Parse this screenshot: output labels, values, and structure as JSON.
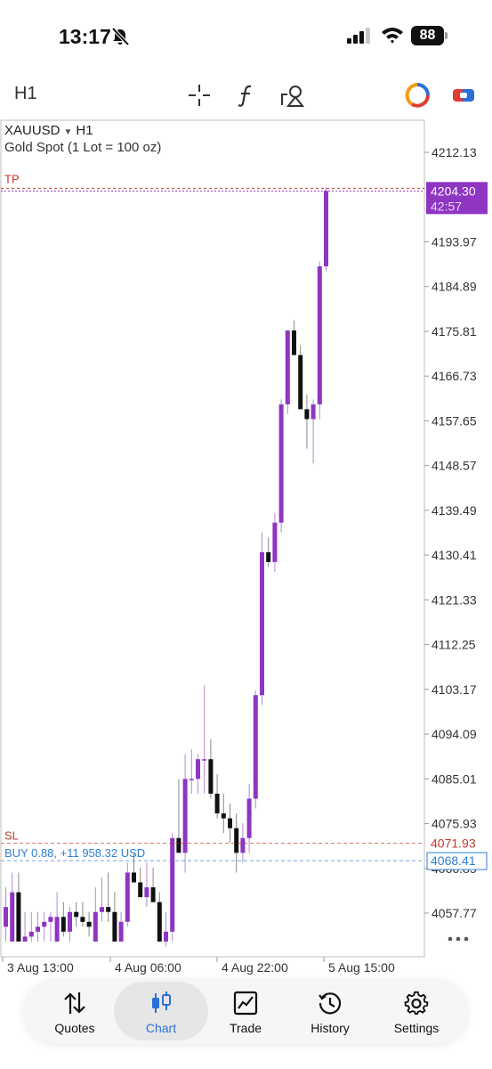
{
  "status_bar": {
    "time": "13:17",
    "battery": "88"
  },
  "toolbar": {
    "timeframe": "H1",
    "icons": [
      "crosshair-icon",
      "function-icon",
      "objects-icon",
      "account-icon",
      "trade-toggle-icon"
    ]
  },
  "tabs": [
    "Quotes",
    "Chart",
    "Trade",
    "History",
    "Settings"
  ],
  "active_tab": "Chart",
  "chart": {
    "symbol": "XAUUSD",
    "timeframe": "H1",
    "description": "Gold Spot (1 Lot = 100 oz)",
    "price_axis": [
      "4212.13",
      "4193.97",
      "4184.89",
      "4175.81",
      "4166.73",
      "4157.65",
      "4148.57",
      "4139.49",
      "4130.41",
      "4121.33",
      "4112.25",
      "4103.17",
      "4094.09",
      "4085.01",
      "4075.93",
      "4066.85",
      "4057.77"
    ],
    "time_axis": [
      "3 Aug 13:00",
      "4 Aug 06:00",
      "4 Aug 22:00",
      "5 Aug 15:00"
    ],
    "current_price": "4204.30",
    "countdown": "42:57",
    "tp_label": "TP",
    "sl_label": "SL",
    "sl_price": "4071.93",
    "position_label": "BUY 0.88, +11 958.32 USD",
    "position_price": "4068.41",
    "colors": {
      "bull": "#8e35c2",
      "bear": "#111111",
      "current": "#8e35c2",
      "tp": "#c0392b",
      "sl": "#c0392b",
      "position": "#2f7fd6"
    }
  },
  "chart_data": {
    "type": "candlestick",
    "price_range": [
      4052.0,
      4218.0
    ],
    "candles": [
      {
        "o": 4055,
        "h": 4063,
        "l": 4052,
        "c": 4059
      },
      {
        "o": 4052,
        "h": 4066,
        "l": 4052,
        "c": 4062
      },
      {
        "o": 4062,
        "h": 4066,
        "l": 4052,
        "c": 4052
      },
      {
        "o": 4052,
        "h": 4058,
        "l": 4052,
        "c": 4053
      },
      {
        "o": 4053,
        "h": 4058,
        "l": 4052,
        "c": 4054
      },
      {
        "o": 4054,
        "h": 4058,
        "l": 4052,
        "c": 4055
      },
      {
        "o": 4055,
        "h": 4058,
        "l": 4052,
        "c": 4056
      },
      {
        "o": 4056,
        "h": 4058,
        "l": 4052,
        "c": 4057
      },
      {
        "o": 4052,
        "h": 4062,
        "l": 4052,
        "c": 4057
      },
      {
        "o": 4057,
        "h": 4060,
        "l": 4053,
        "c": 4054
      },
      {
        "o": 4054,
        "h": 4059,
        "l": 4052,
        "c": 4058
      },
      {
        "o": 4058,
        "h": 4060,
        "l": 4055,
        "c": 4057
      },
      {
        "o": 4057,
        "h": 4060,
        "l": 4055,
        "c": 4056
      },
      {
        "o": 4056,
        "h": 4058,
        "l": 4053,
        "c": 4055
      },
      {
        "o": 4052,
        "h": 4063,
        "l": 4052,
        "c": 4058
      },
      {
        "o": 4058,
        "h": 4065,
        "l": 4056,
        "c": 4059
      },
      {
        "o": 4059,
        "h": 4066,
        "l": 4056,
        "c": 4058
      },
      {
        "o": 4058,
        "h": 4062,
        "l": 4052,
        "c": 4052
      },
      {
        "o": 4052,
        "h": 4058,
        "l": 4052,
        "c": 4056
      },
      {
        "o": 4056,
        "h": 4068,
        "l": 4055,
        "c": 4066
      },
      {
        "o": 4066,
        "h": 4070,
        "l": 4064,
        "c": 4064
      },
      {
        "o": 4064,
        "h": 4067,
        "l": 4062,
        "c": 4061
      },
      {
        "o": 4061,
        "h": 4068,
        "l": 4059,
        "c": 4063
      },
      {
        "o": 4063,
        "h": 4067,
        "l": 4060,
        "c": 4060
      },
      {
        "o": 4060,
        "h": 4062,
        "l": 4052,
        "c": 4052
      },
      {
        "o": 4052,
        "h": 4058,
        "l": 4051,
        "c": 4054
      },
      {
        "o": 4054,
        "h": 4074,
        "l": 4052,
        "c": 4073
      },
      {
        "o": 4073,
        "h": 4085,
        "l": 4070,
        "c": 4070
      },
      {
        "o": 4070,
        "h": 4090,
        "l": 4066,
        "c": 4085
      },
      {
        "o": 4085,
        "h": 4091,
        "l": 4082,
        "c": 4085
      },
      {
        "o": 4085,
        "h": 4090,
        "l": 4082,
        "c": 4089
      },
      {
        "o": 4089,
        "h": 4104,
        "l": 4082,
        "c": 4089
      },
      {
        "o": 4089,
        "h": 4093,
        "l": 4081,
        "c": 4082
      },
      {
        "o": 4082,
        "h": 4086,
        "l": 4077,
        "c": 4078
      },
      {
        "o": 4078,
        "h": 4082,
        "l": 4074,
        "c": 4077
      },
      {
        "o": 4077,
        "h": 4080,
        "l": 4072,
        "c": 4075
      },
      {
        "o": 4075,
        "h": 4078,
        "l": 4066,
        "c": 4070
      },
      {
        "o": 4070,
        "h": 4076,
        "l": 4068,
        "c": 4073
      },
      {
        "o": 4073,
        "h": 4084,
        "l": 4070,
        "c": 4081
      },
      {
        "o": 4081,
        "h": 4103,
        "l": 4079,
        "c": 4102
      },
      {
        "o": 4102,
        "h": 4135,
        "l": 4100,
        "c": 4131
      },
      {
        "o": 4131,
        "h": 4134,
        "l": 4128,
        "c": 4129
      },
      {
        "o": 4129,
        "h": 4139,
        "l": 4127,
        "c": 4137
      },
      {
        "o": 4137,
        "h": 4162,
        "l": 4135,
        "c": 4161
      },
      {
        "o": 4161,
        "h": 4175,
        "l": 4159,
        "c": 4176
      },
      {
        "o": 4176,
        "h": 4178,
        "l": 4171,
        "c": 4171
      },
      {
        "o": 4171,
        "h": 4173,
        "l": 4160,
        "c": 4160
      },
      {
        "o": 4160,
        "h": 4163,
        "l": 4152,
        "c": 4158
      },
      {
        "o": 4158,
        "h": 4162,
        "l": 4149,
        "c": 4161
      },
      {
        "o": 4161,
        "h": 4190,
        "l": 4158,
        "c": 4189
      },
      {
        "o": 4189,
        "h": 4205,
        "l": 4188,
        "c": 4204.3
      }
    ]
  }
}
